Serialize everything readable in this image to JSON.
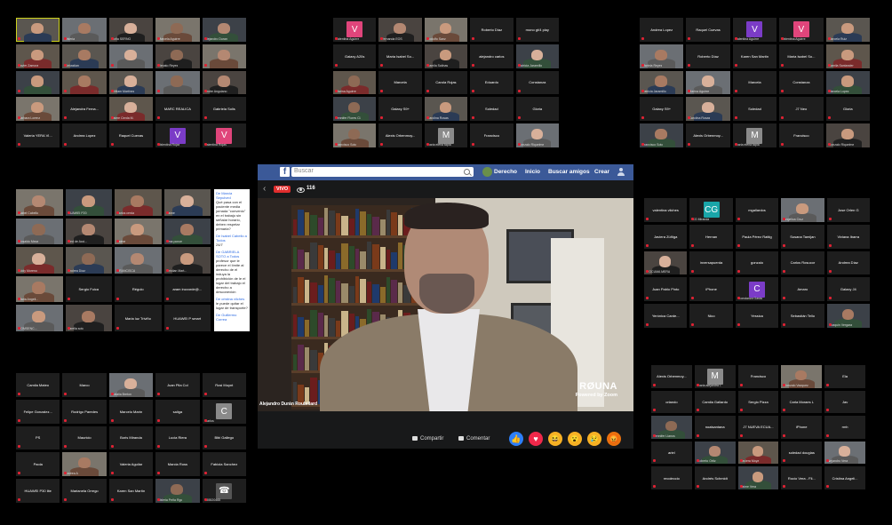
{
  "grids": [
    {
      "id": "g1",
      "cols": 5,
      "rows": 5,
      "tiles": [
        {
          "v": 1,
          "n": "",
          "active": 1
        },
        {
          "v": 1,
          "n": "Valeria"
        },
        {
          "v": 1,
          "n": "Sofia SERNO"
        },
        {
          "v": 1,
          "n": "Marcela Aguirre"
        },
        {
          "v": 1,
          "n": "Alejandro Duran"
        },
        {
          "v": 1,
          "n": "Javier Zamora"
        },
        {
          "v": 1,
          "n": "Sebastian"
        },
        {
          "v": 1,
          "n": ""
        },
        {
          "v": 1,
          "n": "Renato Reyes"
        },
        {
          "v": 1,
          "n": ""
        },
        {
          "v": 1,
          "n": ""
        },
        {
          "v": 1,
          "n": ""
        },
        {
          "v": 1,
          "n": "William Martinez"
        },
        {
          "v": 1,
          "n": ""
        },
        {
          "v": 1,
          "n": "Andre Anguiano"
        },
        {
          "v": 1,
          "n": "Barbara Lorenz"
        },
        {
          "n": "Alejandra Ferna..."
        },
        {
          "v": 1,
          "n": "Jaime Cerda M."
        },
        {
          "n": "MARC REALICA"
        },
        {
          "n": "Gabriela Solis"
        },
        {
          "n": "Valeria YERA VI..."
        },
        {
          "n": "Andrea Lopez"
        },
        {
          "n": "Raquel Cuevas"
        },
        {
          "av": "V",
          "c": "#7b3cc7",
          "n": "Valentina Rojas"
        },
        {
          "av": "V",
          "c": "#e0457b",
          "n": "Valentina Rojas"
        }
      ]
    },
    {
      "id": "g2",
      "cols": 5,
      "rows": 5,
      "tiles": [
        {
          "av": "V",
          "c": "#e0457b",
          "n": "Valentina Aguirre"
        },
        {
          "v": 1,
          "n": "Fernanda EOS"
        },
        {
          "v": 1,
          "n": "Rodolfo Sanz"
        },
        {
          "n": "Roberto Díaz"
        },
        {
          "n": "mono gt/4 play"
        },
        {
          "n": "Galaxy A20s"
        },
        {
          "n": "Maria Isabel So..."
        },
        {
          "v": 1,
          "n": "Camila Salinas"
        },
        {
          "n": "alejandro carlos"
        },
        {
          "v": 1,
          "n": "Patricia Jaramillo"
        },
        {
          "v": 1,
          "n": "Marina Aguirre"
        },
        {
          "n": "Marcela"
        },
        {
          "n": "Carola Rojas"
        },
        {
          "n": "Eduardo"
        },
        {
          "n": "Constanza"
        },
        {
          "v": 1,
          "n": "Jennifer Flores Cl."
        },
        {
          "n": "Galaxy S9+"
        },
        {
          "v": 1,
          "n": "Carolina Rosas"
        },
        {
          "n": "Soledad"
        },
        {
          "n": "Gloria"
        },
        {
          "v": 1,
          "n": "Francisco Soto"
        },
        {
          "n": "Alexis Orbenmoy..."
        },
        {
          "av": "M",
          "c": "#8a8a8a",
          "n": "maria elena tapia"
        },
        {
          "n": "Francisco"
        },
        {
          "v": 1,
          "n": "Gonzalo Riquelme"
        }
      ]
    },
    {
      "id": "g3",
      "cols": 5,
      "rows": 5,
      "tiles": [
        {
          "n": "Andrea Lopez"
        },
        {
          "n": "Raquel Cuevas"
        },
        {
          "av": "V",
          "c": "#7b3cc7",
          "n": "Valentina Aguirre"
        },
        {
          "av": "V",
          "c": "#e0457b",
          "n": "Valentina Aguirre"
        },
        {
          "v": 1,
          "n": "Marcela Ruiz"
        },
        {
          "v": 1,
          "n": "Mariela Reyes"
        },
        {
          "n": "Roberto Díaz"
        },
        {
          "n": "Karen San Martin"
        },
        {
          "n": "Maria Isabel So..."
        },
        {
          "v": 1,
          "n": "Camila Santander"
        },
        {
          "v": 1,
          "n": "Patricia Jaramillo"
        },
        {
          "v": 1,
          "n": "Marina Aguirre"
        },
        {
          "n": "Marcela"
        },
        {
          "n": "Constanza"
        },
        {
          "v": 1,
          "n": "Marcela Lopez"
        },
        {
          "n": "Galaxy S9+"
        },
        {
          "v": 1,
          "n": "Carolina Rosas"
        },
        {
          "n": "Soledad"
        },
        {
          "n": "J7 Neo"
        },
        {
          "n": "Gloria"
        },
        {
          "v": 1,
          "n": "Francisco Soto"
        },
        {
          "n": "Alexis Orbenmoy..."
        },
        {
          "av": "M",
          "c": "#8a8a8a",
          "n": "maria elena tapia"
        },
        {
          "n": "Francisco"
        },
        {
          "v": 1,
          "n": "Gonzalo Riquelme"
        }
      ]
    },
    {
      "id": "g4",
      "cols": 4,
      "rows": 5,
      "tiles": [
        {
          "v": 1,
          "n": "Isabel Cabello"
        },
        {
          "v": 1,
          "n": "HUAWEI P20"
        },
        {
          "v": 1,
          "n": "carlos cerda"
        },
        {
          "v": 1,
          "n": "Jaime"
        },
        {
          "v": 1,
          "n": "Rosaldo Meza"
        },
        {
          "v": 1,
          "n": "Red de Acci..."
        },
        {
          "v": 1,
          "n": "Jaime"
        },
        {
          "v": 1,
          "n": "Irma ponce"
        },
        {
          "v": 1,
          "n": "Eddy Moreno"
        },
        {
          "v": 1,
          "n": "Andrea Díaz"
        },
        {
          "v": 1,
          "n": "FRANCISCA"
        },
        {
          "v": 1,
          "n": "Cristian Mart..."
        },
        {
          "v": 1,
          "n": "Maria Angeli..."
        },
        {
          "n": "Sergio Fuica"
        },
        {
          "n": "Régulo"
        },
        {
          "n": "aram inzzorde@..."
        },
        {
          "v": 1,
          "n": "YOMSENC..."
        },
        {
          "v": 1,
          "n": "yarella soto"
        },
        {
          "n": "Maria luz Triviño"
        },
        {
          "n": "HUAWEI P smart"
        }
      ]
    },
    {
      "id": "g5",
      "cols": 5,
      "rows": 5,
      "tiles": [
        {
          "n": "valentina vilches"
        },
        {
          "av": "CG",
          "c": "#19a5a8",
          "n": "CG Miranda"
        },
        {
          "n": "mgallardos"
        },
        {
          "v": 1,
          "n": "Angelica Cruz"
        },
        {
          "n": "Jose Orlen G"
        },
        {
          "n": "Javiera Zúñiga"
        },
        {
          "n": "Hernan"
        },
        {
          "n": "Paula Pérez Rattig"
        },
        {
          "n": "Susana Tamijan"
        },
        {
          "n": "Viviana Ibarra"
        },
        {
          "v": 1,
          "n": "YOCUMA MERA"
        },
        {
          "n": "inversapuerda"
        },
        {
          "n": "gonzalo"
        },
        {
          "n": "Carlos Rosucor"
        },
        {
          "n": "Andrea Díaz"
        },
        {
          "n": "Juan Pablo Pinto"
        },
        {
          "n": "iPhone"
        },
        {
          "av": "C",
          "c": "#7b3cc7",
          "n": "Constanza Gasta"
        },
        {
          "n": "Amaro"
        },
        {
          "n": "Galaxy J4"
        },
        {
          "n": "Yerónica Carde..."
        },
        {
          "n": "Nico"
        },
        {
          "n": "Yessica"
        },
        {
          "n": "Sebastián Tello"
        },
        {
          "v": 1,
          "n": "Joaquin Vergara"
        }
      ]
    },
    {
      "id": "g6",
      "cols": 5,
      "rows": 5,
      "tiles": [
        {
          "n": "Camila Mateo"
        },
        {
          "n": "Marco"
        },
        {
          "v": 1,
          "n": "Natalia Breton"
        },
        {
          "n": "Juan Pila Col"
        },
        {
          "n": "Rosi Muynt"
        },
        {
          "n": "Felipe Gonzalez..."
        },
        {
          "n": "Rodrigo Paredes"
        },
        {
          "n": "Marcelo Marín"
        },
        {
          "n": "saliga"
        },
        {
          "av": "C",
          "c": "#8a8a8a",
          "n": "Carlos"
        },
        {
          "n": "PS"
        },
        {
          "n": "Mauricio"
        },
        {
          "n": "Boris Miranda"
        },
        {
          "n": "Lucia Riera"
        },
        {
          "n": "Bibi Gallego"
        },
        {
          "n": "Paola"
        },
        {
          "v": 1,
          "n": "Andrea A"
        },
        {
          "n": "Valeria Aguilar"
        },
        {
          "n": "Marcia Ross"
        },
        {
          "n": "Fabiola Sanchez"
        },
        {
          "n": "HUAWEI P30 lite"
        },
        {
          "n": "Marianela Orrego"
        },
        {
          "n": "Karen San Martín"
        },
        {
          "v": 1,
          "n": "Valeria Peña Rgo"
        },
        {
          "av": "☎",
          "c": "#555",
          "n": "555520465"
        }
      ]
    },
    {
      "id": "g7",
      "cols": 5,
      "rows": 5,
      "tiles": [
        {
          "n": "Alexis Orbenmoy..."
        },
        {
          "av": "M",
          "c": "#8a8a8a",
          "n": "maria alejandra l."
        },
        {
          "n": "Francisco"
        },
        {
          "v": 1,
          "n": "Gonzalo Vazquez"
        },
        {
          "n": "Ela"
        },
        {
          "n": "orlando"
        },
        {
          "n": "Camila Gallardo"
        },
        {
          "n": "Sergio Pizza"
        },
        {
          "n": "Carla Moraes L"
        },
        {
          "n": "Jav"
        },
        {
          "v": 1,
          "n": "Jennifer Llanos"
        },
        {
          "n": "noalsantana"
        },
        {
          "n": "J7 NUEVA ECUA..."
        },
        {
          "n": "iPhone"
        },
        {
          "n": "rmh"
        },
        {
          "n": "ariel"
        },
        {
          "v": 1,
          "n": "Roberto Ortiz"
        },
        {
          "v": 1,
          "n": "Javiera Moya"
        },
        {
          "n": "soledad douglas"
        },
        {
          "v": 1,
          "n": "Alejandro Vera"
        },
        {
          "n": "recoleccio"
        },
        {
          "n": "Andrés Schmidt"
        },
        {
          "v": 1,
          "n": "Jaime Vera"
        },
        {
          "n": "Rocío Vera - Fli..."
        },
        {
          "n": "Cristina Angeli..."
        }
      ]
    }
  ],
  "chat": {
    "messages": [
      {
        "who": "De Marcia Sepulved",
        "text": "Qué pasa con el paciente media jornada \"convenio\" en el trabajo sin señalar horario, deben respetar primaria?"
      },
      {
        "who": "De Isabel Cabello a Todos",
        "text": "24/7"
      },
      {
        "who": "De GABRIELA SOTO a Todos",
        "text": "profesor que le parece el límite al derecho de el induya la prohibición de le el lugar del trabajo el derecho a desconexión"
      },
      {
        "who": "De cristina vilches",
        "text": "le puede quitar el lugar de transporte?"
      },
      {
        "who": "De Guillermo Correa",
        "text": ""
      }
    ]
  },
  "facebook": {
    "search_placeholder": "Buscar",
    "nav": [
      "Derecho",
      "Inicio",
      "Buscar amigos",
      "Crear"
    ],
    "live_badge": "VIVO",
    "viewers": "116",
    "speaker_name": "Alejandro Durán Roubillard",
    "brand": "RØUNA",
    "powered_by": "Powered by Zoom",
    "share_label": "Compartir",
    "comment_label": "Comentar",
    "reactions": [
      {
        "name": "like",
        "icon": "👍",
        "color": "#2d7ff9"
      },
      {
        "name": "love",
        "icon": "♥",
        "color": "#f0284a"
      },
      {
        "name": "haha",
        "icon": "😆",
        "color": "#f7b125"
      },
      {
        "name": "wow",
        "icon": "😮",
        "color": "#f7b125"
      },
      {
        "name": "sad",
        "icon": "😢",
        "color": "#f7b125"
      },
      {
        "name": "angry",
        "icon": "😡",
        "color": "#e9710f"
      }
    ]
  }
}
